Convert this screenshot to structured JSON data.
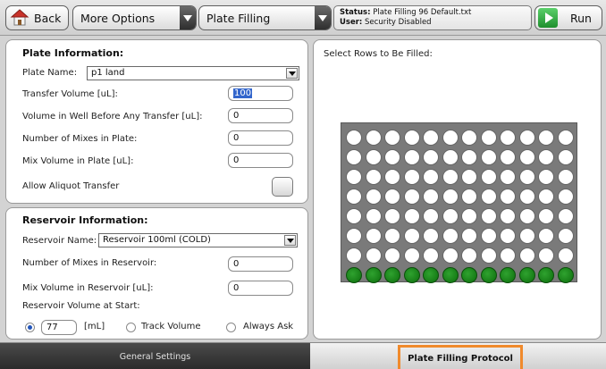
{
  "toolbar": {
    "back_label": "Back",
    "more_options_label": "More Options",
    "mode_label": "Plate Filling",
    "status_label": "Status:",
    "status_value": "Plate Filling 96 Default.txt",
    "user_label": "User:",
    "user_value": "Security Disabled",
    "run_label": "Run"
  },
  "plate_info": {
    "title": "Plate Information:",
    "plate_name_label": "Plate Name:",
    "plate_name_value": "p1 land",
    "transfer_volume_label": "Transfer Volume [uL]:",
    "transfer_volume_value": "100",
    "volume_in_well_label": "Volume in Well Before Any Transfer [uL]:",
    "volume_in_well_value": "0",
    "mixes_in_plate_label": "Number of Mixes in Plate:",
    "mixes_in_plate_value": "0",
    "mix_volume_plate_label": "Mix Volume in Plate [uL]:",
    "mix_volume_plate_value": "0",
    "allow_aliquot_label": "Allow Aliquot Transfer",
    "allow_aliquot_checked": false
  },
  "reservoir_info": {
    "title": "Reservoir Information:",
    "reservoir_name_label": "Reservoir Name:",
    "reservoir_name_value": "Reservoir 100ml (COLD)",
    "mixes_in_reservoir_label": "Number of Mixes in Reservoir:",
    "mixes_in_reservoir_value": "0",
    "mix_volume_reservoir_label": "Mix Volume in Reservoir [uL]:",
    "mix_volume_reservoir_value": "0",
    "volume_at_start_label": "Reservoir Volume at Start:",
    "volume_at_start_value": "77",
    "volume_unit": "[mL]",
    "track_volume_label": "Track Volume",
    "always_ask_label": "Always Ask",
    "selected_option": "value"
  },
  "rows_panel": {
    "title": "Select Rows to Be Filled:",
    "rows": 8,
    "columns": 12,
    "filled_rows": [
      8
    ],
    "empty_color": "#ffffff",
    "filled_color": "#1a8a1a"
  },
  "bottom_tabs": {
    "general_label": "General Settings",
    "protocol_label": "Plate Filling Protocol",
    "active": "protocol",
    "active_color": "#f08a2c"
  }
}
